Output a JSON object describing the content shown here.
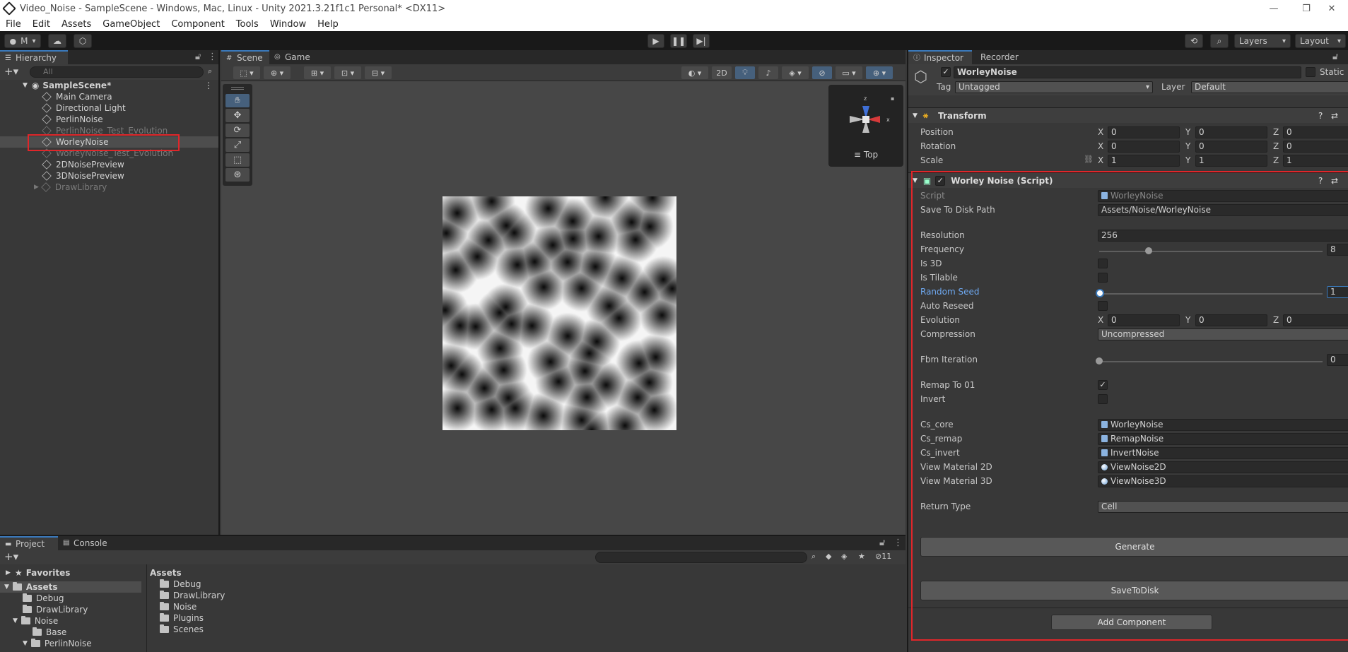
{
  "window": {
    "title": "Video_Noise - SampleScene - Windows, Mac, Linux - Unity 2021.3.21f1c1 Personal* <DX11>",
    "minimize": "—",
    "restore": "❐",
    "close": "✕"
  },
  "menu": [
    "File",
    "Edit",
    "Assets",
    "GameObject",
    "Component",
    "Tools",
    "Window",
    "Help"
  ],
  "toolbar": {
    "account_label": "M",
    "layers_label": "Layers",
    "layout_label": "Layout"
  },
  "hierarchy": {
    "tab_label": "Hierarchy",
    "search_placeholder": "All",
    "scene_name": "SampleScene*",
    "items": [
      {
        "label": "Main Camera",
        "dim": false
      },
      {
        "label": "Directional Light",
        "dim": false
      },
      {
        "label": "PerlinNoise",
        "dim": false
      },
      {
        "label": "PerlinNoise_Test_Evolution",
        "dim": true
      },
      {
        "label": "WorleyNoise",
        "dim": false,
        "selected": true
      },
      {
        "label": "WorleyNoise_Test_Evolution",
        "dim": true
      },
      {
        "label": "2DNoisePreview",
        "dim": false
      },
      {
        "label": "3DNoisePreview",
        "dim": false
      },
      {
        "label": "DrawLibrary",
        "dim": true
      }
    ]
  },
  "scene": {
    "tabs": [
      "Scene",
      "Game"
    ],
    "mode_2d": "2D",
    "gizmo_label": "Top",
    "axis_x": "x",
    "axis_z": "z"
  },
  "project": {
    "tabs": [
      "Project",
      "Console"
    ],
    "favorites_label": "Favorites",
    "tree": [
      {
        "label": "Assets",
        "level": 0,
        "bold": true
      },
      {
        "label": "Debug",
        "level": 1
      },
      {
        "label": "DrawLibrary",
        "level": 1
      },
      {
        "label": "Noise",
        "level": 1
      },
      {
        "label": "Base",
        "level": 2
      },
      {
        "label": "PerlinNoise",
        "level": 2
      }
    ],
    "content_header": "Assets",
    "content_items": [
      "Debug",
      "DrawLibrary",
      "Noise",
      "Plugins",
      "Scenes"
    ],
    "hidden_count": "11"
  },
  "inspector": {
    "tabs": [
      "Inspector",
      "Recorder"
    ],
    "object_name": "WorleyNoise",
    "static_label": "Static",
    "tag_label": "Tag",
    "tag_value": "Untagged",
    "layer_label": "Layer",
    "layer_value": "Default",
    "transform": {
      "title": "Transform",
      "rows": [
        {
          "label": "Position",
          "x": "0",
          "y": "0",
          "z": "0"
        },
        {
          "label": "Rotation",
          "x": "0",
          "y": "0",
          "z": "0"
        },
        {
          "label": "Scale",
          "x": "1",
          "y": "1",
          "z": "1"
        }
      ]
    },
    "script_component": {
      "title": "Worley Noise (Script)",
      "script_label": "Script",
      "script_value": "WorleyNoise",
      "save_path_label": "Save To Disk Path",
      "save_path_value": "Assets/Noise/WorleyNoise",
      "resolution_label": "Resolution",
      "resolution_value": "256",
      "frequency_label": "Frequency",
      "frequency_value": "8",
      "frequency_fraction": 0.22,
      "is3d_label": "Is 3D",
      "is3d_checked": false,
      "tilable_label": "Is Tilable",
      "tilable_checked": false,
      "seed_label": "Random Seed",
      "seed_value": "1",
      "seed_fraction": 0.0,
      "autoreseed_label": "Auto Reseed",
      "autoreseed_checked": false,
      "evolution_label": "Evolution",
      "evolution": {
        "x": "0",
        "y": "0",
        "z": "0"
      },
      "compression_label": "Compression",
      "compression_value": "Uncompressed",
      "fbm_label": "Fbm Iteration",
      "fbm_value": "0",
      "fbm_fraction": 0.0,
      "remap_label": "Remap To 01",
      "remap_checked": true,
      "invert_label": "Invert",
      "invert_checked": false,
      "cs_core_label": "Cs_core",
      "cs_core_value": "WorleyNoise",
      "cs_remap_label": "Cs_remap",
      "cs_remap_value": "RemapNoise",
      "cs_invert_label": "Cs_invert",
      "cs_invert_value": "InvertNoise",
      "mat2d_label": "View Material 2D",
      "mat2d_value": "ViewNoise2D",
      "mat3d_label": "View Material 3D",
      "mat3d_value": "ViewNoise3D",
      "return_type_label": "Return Type",
      "return_type_value": "Cell",
      "generate_label": "Generate",
      "save_label": "SaveToDisk"
    },
    "add_component_label": "Add Component"
  },
  "colors": {
    "accent_blue": "#3a79bb",
    "highlight_red": "#e0262a",
    "seed_label_blue": "#6ea8f0"
  }
}
